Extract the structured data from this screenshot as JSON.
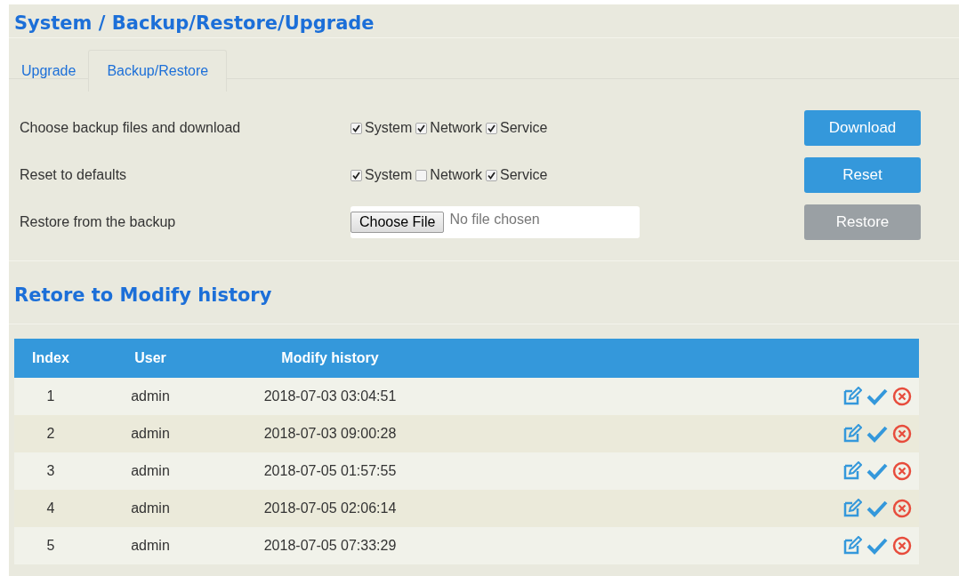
{
  "title": "System / Backup/Restore/Upgrade",
  "tabs": [
    {
      "label": "Upgrade",
      "selected": false
    },
    {
      "label": "Backup/Restore",
      "selected": true
    }
  ],
  "rows": [
    {
      "kind": "checkboxes",
      "label": "Choose backup files and download",
      "options": [
        {
          "label": "System",
          "checked": true
        },
        {
          "label": "Network",
          "checked": true
        },
        {
          "label": "Service",
          "checked": true
        }
      ],
      "button": {
        "label": "Download",
        "disabled": false
      }
    },
    {
      "kind": "checkboxes",
      "label": "Reset to defaults",
      "options": [
        {
          "label": "System",
          "checked": true
        },
        {
          "label": "Network",
          "checked": false
        },
        {
          "label": "Service",
          "checked": true
        }
      ],
      "button": {
        "label": "Reset",
        "disabled": false
      }
    },
    {
      "kind": "file",
      "label": "Restore from the backup",
      "file_button": "Choose File",
      "file_status": "No file chosen",
      "button": {
        "label": "Restore",
        "disabled": true
      }
    }
  ],
  "history": {
    "title": "Retore to Modify history",
    "columns": [
      "Index",
      "User",
      "Modify history"
    ],
    "rows": [
      [
        "1",
        "admin",
        "2018-07-03 03:04:51"
      ],
      [
        "2",
        "admin",
        "2018-07-03 09:00:28"
      ],
      [
        "3",
        "admin",
        "2018-07-05 01:57:55"
      ],
      [
        "4",
        "admin",
        "2018-07-05 02:06:14"
      ],
      [
        "5",
        "admin",
        "2018-07-05 07:33:29"
      ]
    ]
  }
}
